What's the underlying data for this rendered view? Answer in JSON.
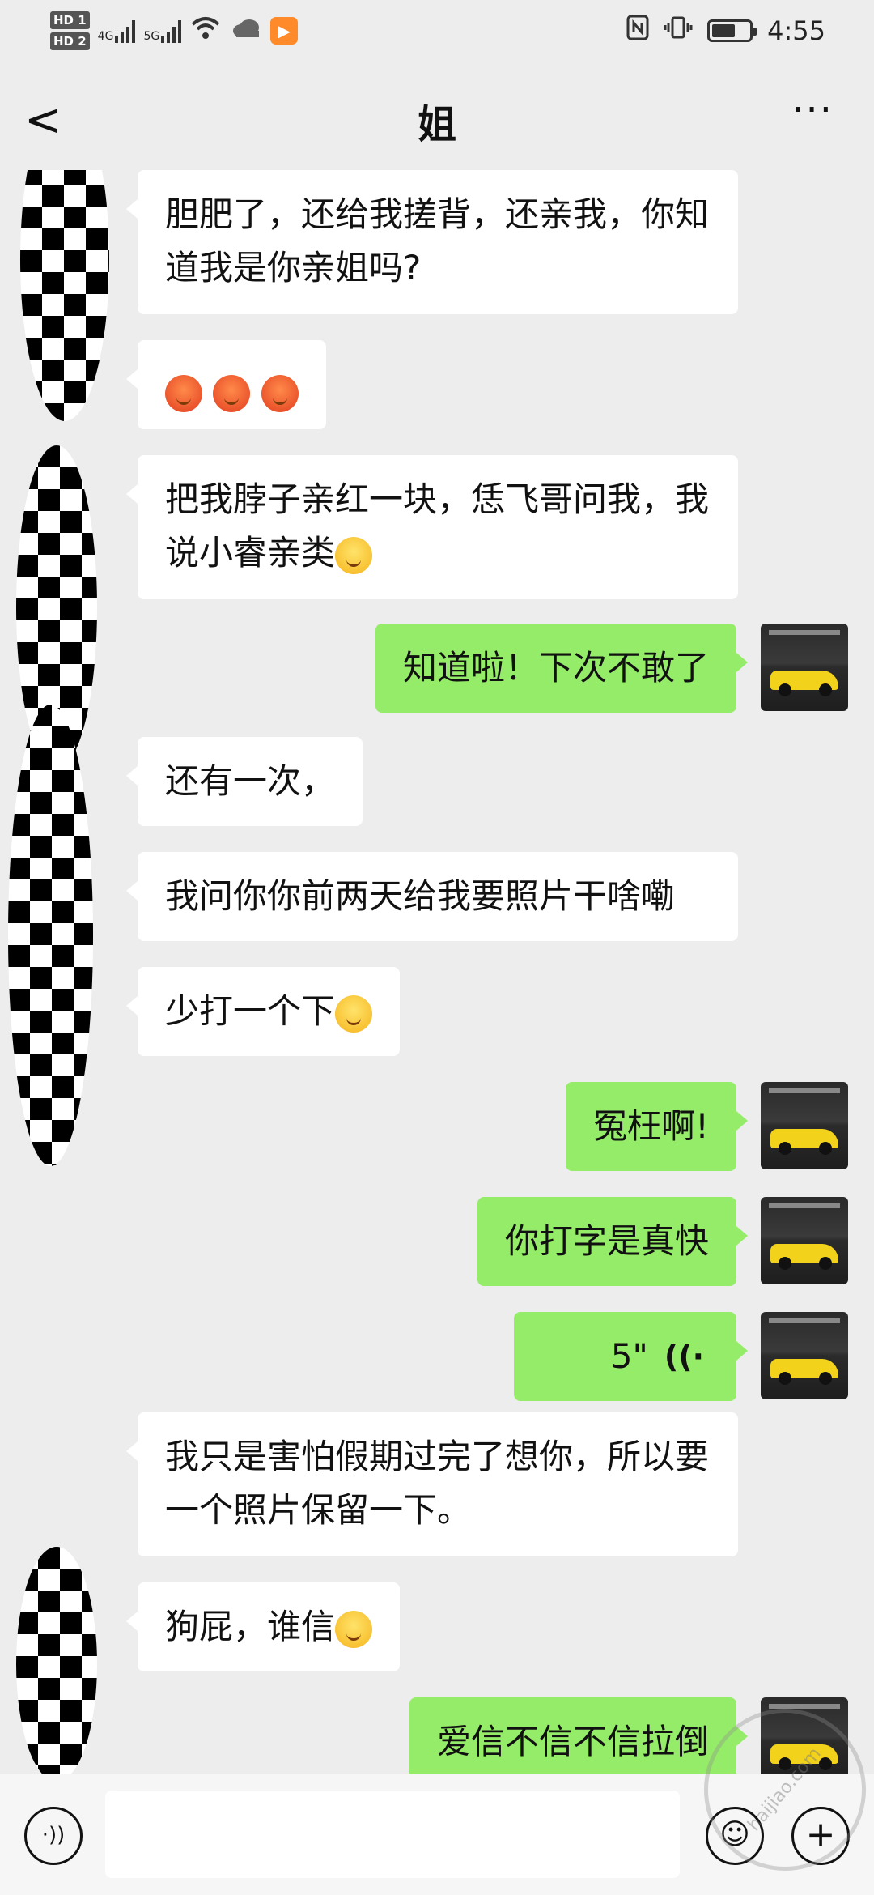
{
  "status_bar": {
    "sim1": "HD 1",
    "sim2": "HD 2",
    "net1": "4G",
    "net2": "5G",
    "time": "4:55",
    "battery_level": 0.55,
    "icons": [
      "wifi-icon",
      "cloud-icon",
      "app-notification-icon",
      "nfc-icon",
      "vibrate-icon",
      "battery-icon"
    ]
  },
  "header": {
    "back_glyph": "<",
    "title": "姐",
    "more_glyph": "···"
  },
  "messages": [
    {
      "side": "left",
      "text": "胆肥了，还给我搓背，还亲我，你知道我是你亲姐吗?"
    },
    {
      "side": "left",
      "emoji": [
        "angry-face",
        "angry-face",
        "angry-face"
      ]
    },
    {
      "side": "left",
      "text": "把我脖子亲红一块，恁飞哥问我，我说小睿亲类",
      "emoji": "smiling-face"
    },
    {
      "side": "right",
      "text": "知道啦！下次不敢了"
    },
    {
      "side": "left",
      "text": "还有一次，"
    },
    {
      "side": "left",
      "text": "我问你你前两天给我要照片干啥嘞"
    },
    {
      "side": "left",
      "text": "少打一个下",
      "emoji": "thinking-face"
    },
    {
      "side": "right",
      "text": "冤枉啊!"
    },
    {
      "side": "right",
      "text": "你打字是真快"
    },
    {
      "side": "right",
      "voice_duration": "5\"",
      "voice_glyph": "((·"
    },
    {
      "side": "left",
      "text": "我只是害怕假期过完了想你，所以要一个照片保留一下。"
    },
    {
      "side": "left",
      "text": "狗屁，谁信",
      "emoji": "winking-face"
    },
    {
      "side": "right",
      "text": "爱信不信不信拉倒"
    }
  ],
  "bottom_bar": {
    "voice_glyph": "·))",
    "input_value": "",
    "emoji_glyph": "☺",
    "plus_glyph": "+"
  },
  "watermark": "haijiao.com"
}
